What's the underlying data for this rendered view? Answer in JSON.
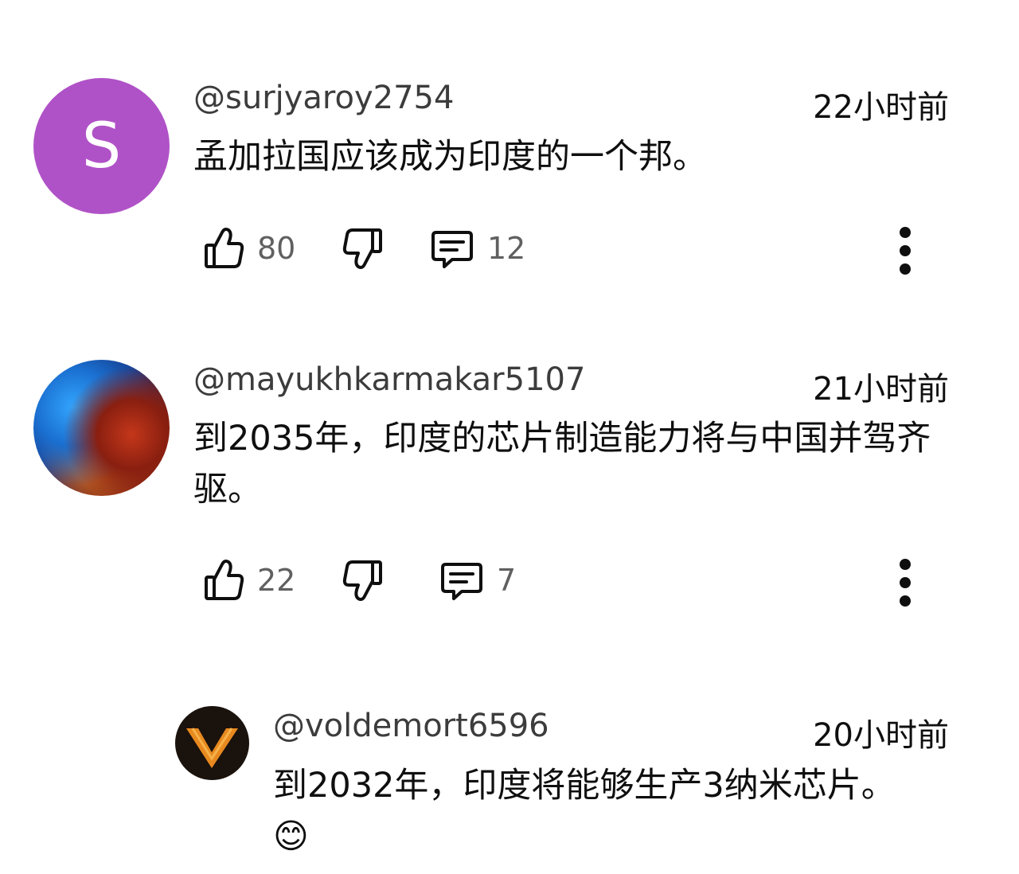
{
  "comments": [
    {
      "author": "@surjyaroy2754",
      "time": "22小时前",
      "text": "孟加拉国应该成为印度的一个邦。",
      "avatar_letter": "S",
      "avatar_color": "#b052c7",
      "likes": "80",
      "replies": "12",
      "icons": [
        "thumb-up-icon",
        "thumb-down-icon",
        "reply-comment-icon",
        "more-vert-icon"
      ]
    },
    {
      "author": "@mayukhkarmakar5107",
      "time": "21小时前",
      "text": "到2035年，印度的芯片制造能力将与中国并驾齐驱。",
      "likes": "22",
      "replies": "7",
      "icons": [
        "thumb-up-icon",
        "thumb-down-icon",
        "reply-comment-icon",
        "more-vert-icon"
      ]
    },
    {
      "author": "@voldemort6596",
      "time": "20小时前",
      "text": "到2032年，印度将能够生产3纳米芯片。😊"
    }
  ]
}
